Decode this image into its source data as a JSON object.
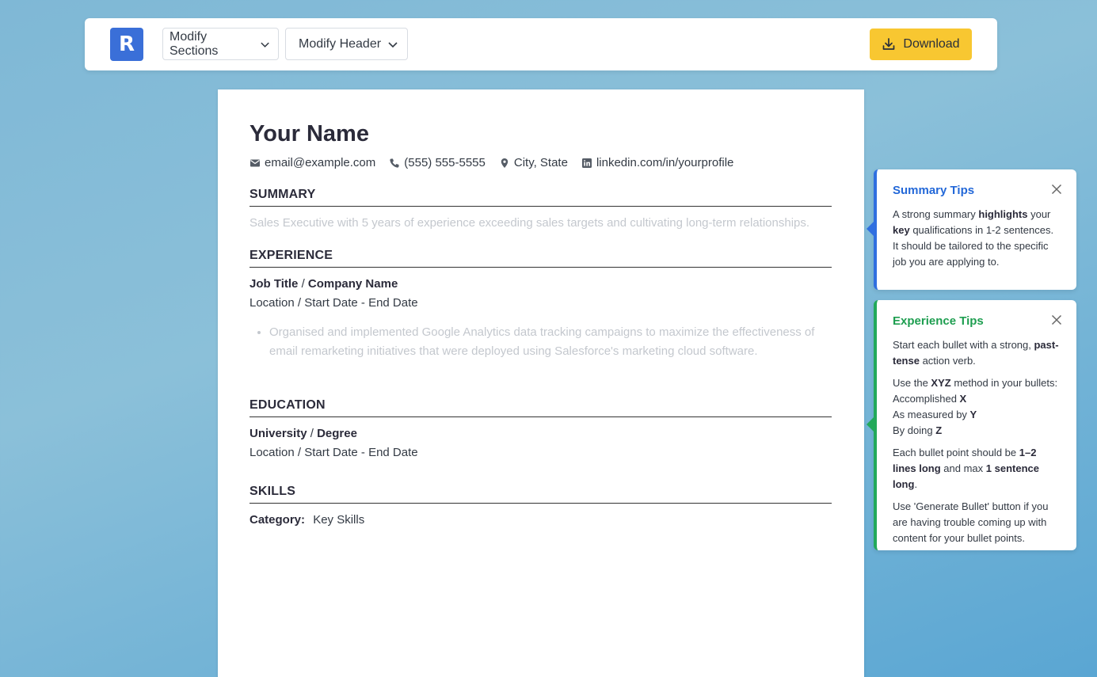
{
  "toolbar": {
    "logo_letter": "R",
    "modify_sections_label": "Modify Sections",
    "modify_header_label": "Modify Header",
    "download_label": "Download",
    "accent_color": "#f8c731",
    "logo_color": "#3a6fd8"
  },
  "resume": {
    "name": "Your Name",
    "contacts": {
      "email": "email@example.com",
      "phone": "(555) 555-5555",
      "location": "City, State",
      "linkedin": "linkedin.com/in/yourprofile"
    },
    "summary": {
      "title": "SUMMARY",
      "placeholder": "Sales Executive with 5 years of experience exceeding sales targets and cultivating long-term relationships."
    },
    "experience": {
      "title": "EXPERIENCE",
      "job_title": "Job Title",
      "separator": "/",
      "company": "Company Name",
      "meta": "Location / Start Date - End Date",
      "bullet": "Organised and implemented Google Analytics data tracking campaigns to maximize the effectiveness of email remarketing initiatives that were deployed using Salesforce's marketing cloud software."
    },
    "education": {
      "title": "EDUCATION",
      "university": "University",
      "separator": "/",
      "degree": "Degree",
      "meta": "Location / Start Date - End Date"
    },
    "skills": {
      "title": "SKILLS",
      "category_label": "Category:",
      "category_value": "Key Skills"
    }
  },
  "tips": {
    "summary": {
      "title": "Summary Tips",
      "color": "#2f6fe0",
      "p1_a": "A strong summary ",
      "p1_b": "highlights",
      "p1_c": " your ",
      "p1_d": "key",
      "p1_e": " qualifications in 1-2 sentences. It should be tailored to the specific job you are applying to."
    },
    "experience": {
      "title": "Experience Tips",
      "color": "#22a95a",
      "p1_a": "Start each bullet with a strong, ",
      "p1_b": "past-tense",
      "p1_c": " action verb.",
      "p2_a": "Use the ",
      "p2_b": "XYZ",
      "p2_c": " method in your bullets:",
      "p2_d": "Accomplished ",
      "p2_e": "X",
      "p2_f": "As measured by ",
      "p2_g": "Y",
      "p2_h": "By doing ",
      "p2_i": "Z",
      "p3_a": "Each bullet point should be ",
      "p3_b": "1–2 lines long",
      "p3_c": " and max ",
      "p3_d": "1 sentence long",
      "p3_e": ".",
      "p4": "Use 'Generate Bullet' button if you are having trouble coming up with content for your bullet points."
    }
  }
}
